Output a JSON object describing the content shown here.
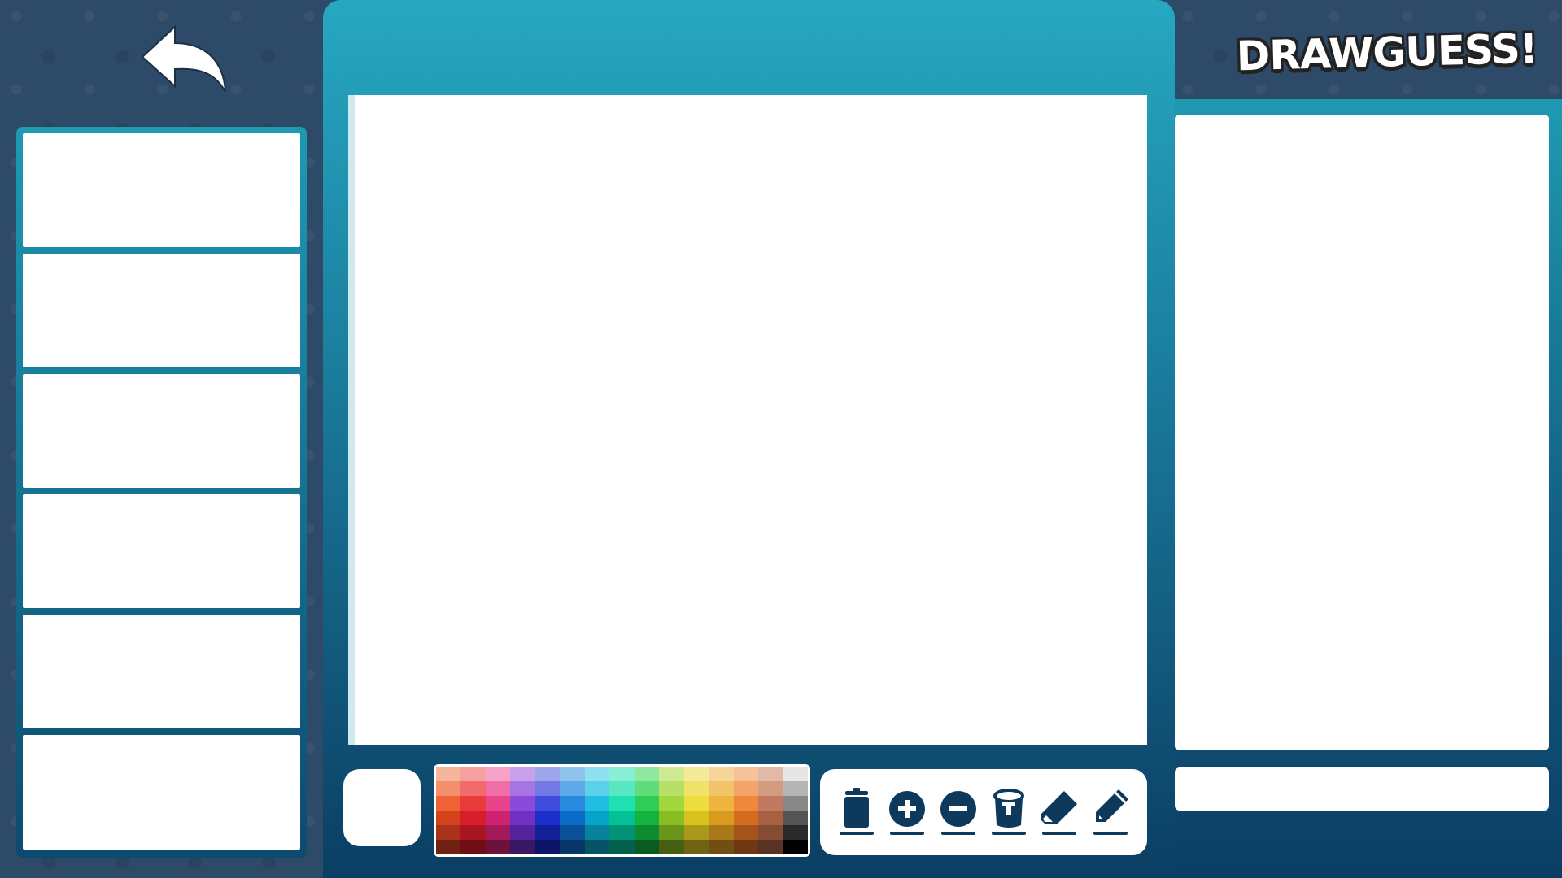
{
  "logo": {
    "text": "DRAWGUESS!"
  },
  "players": {
    "slots": [
      "",
      "",
      "",
      "",
      "",
      ""
    ]
  },
  "chat": {
    "messages": [],
    "input_value": "",
    "input_placeholder": ""
  },
  "current_color": "#ffffff",
  "palette": {
    "colors": [
      "#f7b59b",
      "#f7a0a0",
      "#f7a3c9",
      "#c9a0ea",
      "#a0a6ec",
      "#8fc4ef",
      "#8fe1f1",
      "#88efd6",
      "#8ee8a0",
      "#cfea91",
      "#f4ea98",
      "#f7d49a",
      "#f7c29a",
      "#e2b9a6",
      "#e6e6e6",
      "#f38f6c",
      "#f26a6a",
      "#f06fa8",
      "#a775e3",
      "#7079e4",
      "#5fa8e9",
      "#5cd1ea",
      "#57e8c2",
      "#62dc7a",
      "#b8e068",
      "#f0e16a",
      "#f2c46a",
      "#f3a46a",
      "#d29c83",
      "#b5b5b5",
      "#ee6236",
      "#ea3b3b",
      "#e8438b",
      "#8a4bdc",
      "#3f4ddc",
      "#2988e0",
      "#22bee2",
      "#1fe0b0",
      "#2fcd55",
      "#a1d63e",
      "#eddc3d",
      "#efb43c",
      "#ef873c",
      "#c07a5f",
      "#888888",
      "#d4431c",
      "#d81e2b",
      "#cf2371",
      "#7032c2",
      "#1a2ec9",
      "#0a6ac8",
      "#07a3c8",
      "#03c097",
      "#13b33f",
      "#87bf22",
      "#d8c31d",
      "#d89a1f",
      "#d56b1f",
      "#a86140",
      "#555555",
      "#a8321a",
      "#a91621",
      "#a31a5a",
      "#55249a",
      "#12209a",
      "#0a519a",
      "#08819a",
      "#029275",
      "#0e8a30",
      "#6a941a",
      "#a9981a",
      "#a97819",
      "#a55419",
      "#844c32",
      "#2a2a2a",
      "#6f2212",
      "#700e16",
      "#6c123c",
      "#381863",
      "#0c1565",
      "#073766",
      "#055566",
      "#02604d",
      "#095c20",
      "#465f12",
      "#6f6412",
      "#6f4f12",
      "#6d3812",
      "#583223",
      "#000000"
    ]
  },
  "tools": [
    {
      "name": "trash"
    },
    {
      "name": "zoom-in"
    },
    {
      "name": "zoom-out"
    },
    {
      "name": "bucket"
    },
    {
      "name": "eraser"
    },
    {
      "name": "pencil"
    }
  ]
}
